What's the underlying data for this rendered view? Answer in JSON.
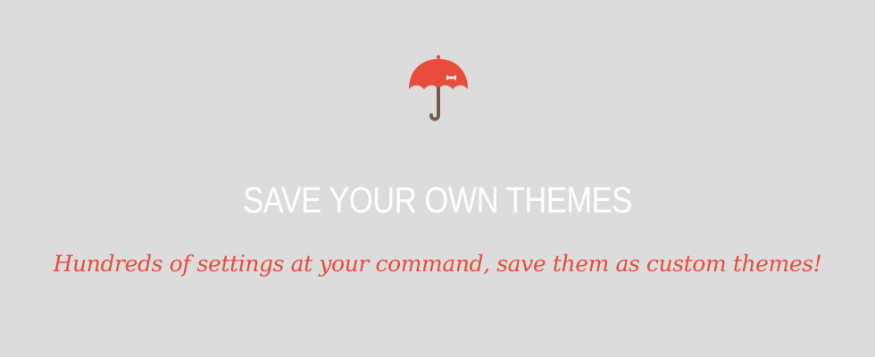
{
  "hero": {
    "icon": "umbrella-icon",
    "title": "SAVE YOUR OWN THEMES",
    "subtitle": "Hundreds of settings at your command, save them as custom themes!"
  },
  "colors": {
    "background": "#dcdcdc",
    "accent": "#e84c3d",
    "title_text": "#ffffff",
    "handle": "#7a5848"
  }
}
